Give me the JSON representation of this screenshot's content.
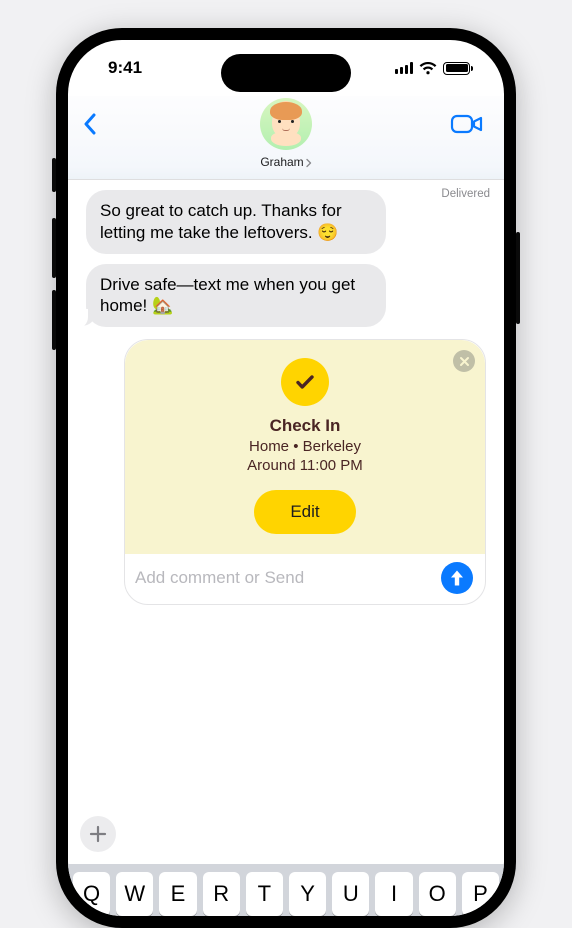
{
  "status": {
    "time": "9:41"
  },
  "nav": {
    "contact_name": "Graham"
  },
  "thread": {
    "delivered_label": "Delivered",
    "messages": [
      "So great to catch up. Thanks for letting me take the leftovers. 😌",
      "Drive safe—text me when you get home! 🏡"
    ]
  },
  "checkin": {
    "title": "Check In",
    "line1": "Home  •  Berkeley",
    "line2": "Around 11:00 PM",
    "edit_label": "Edit"
  },
  "compose": {
    "placeholder": "Add comment or Send"
  },
  "keyboard": {
    "row1": [
      "Q",
      "W",
      "E",
      "R",
      "T",
      "Y",
      "U",
      "I",
      "O",
      "P"
    ]
  },
  "colors": {
    "accent": "#0a7aff",
    "checkin_bg": "#f8f4cf",
    "checkin_yellow": "#ffd400"
  }
}
